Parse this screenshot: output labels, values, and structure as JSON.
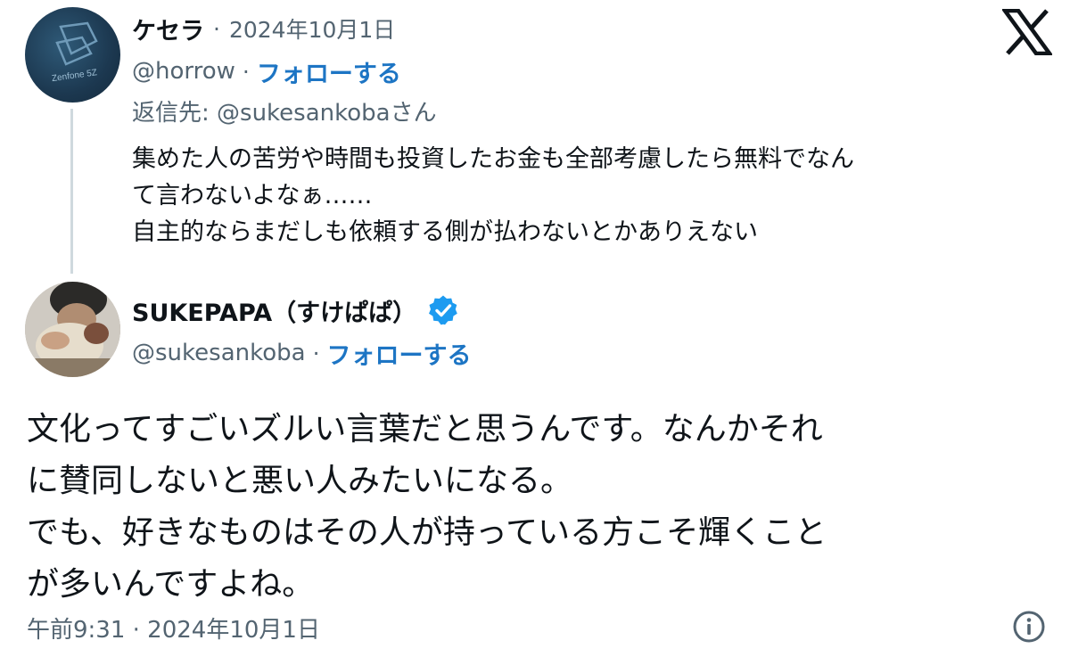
{
  "parent_tweet": {
    "display_name": "ケセラ",
    "separator": "·",
    "date": "2024年10月1日",
    "handle": "@horrow",
    "handle_separator": "·",
    "follow_label": "フォローする",
    "reply_to": "返信先: @sukesankobaさん",
    "avatar_text": "Zenfone 5Z",
    "body_lines": [
      "集めた人の苦労や時間も投資したお金も全部考慮したら無料でなん",
      "て言わないよなぁ……",
      "自主的ならまだしも依頼する側が払わないとかありえない"
    ]
  },
  "main_tweet": {
    "display_name": "SUKEPAPA（すけぱぱ）",
    "verified_icon": "verified-badge-icon",
    "handle": "@sukesankoba",
    "handle_separator": "·",
    "follow_label": "フォローする",
    "body_lines": [
      "文化ってすごいズルい言葉だと思うんです。なんかそれ",
      "に賛同しないと悪い人みたいになる。",
      "でも、好きなものはその人が持っている方こそ輝くこと",
      "が多いんですよね。"
    ],
    "timestamp": "午前9:31 · 2024年10月1日"
  },
  "icons": {
    "brand": "x-logo-icon",
    "info": "info-icon"
  },
  "colors": {
    "link_blue": "#1d75c4",
    "verified_blue": "#1d9bf0",
    "secondary_text": "#536471",
    "primary_text": "#0f1419",
    "thread_line": "#cfd9de"
  }
}
